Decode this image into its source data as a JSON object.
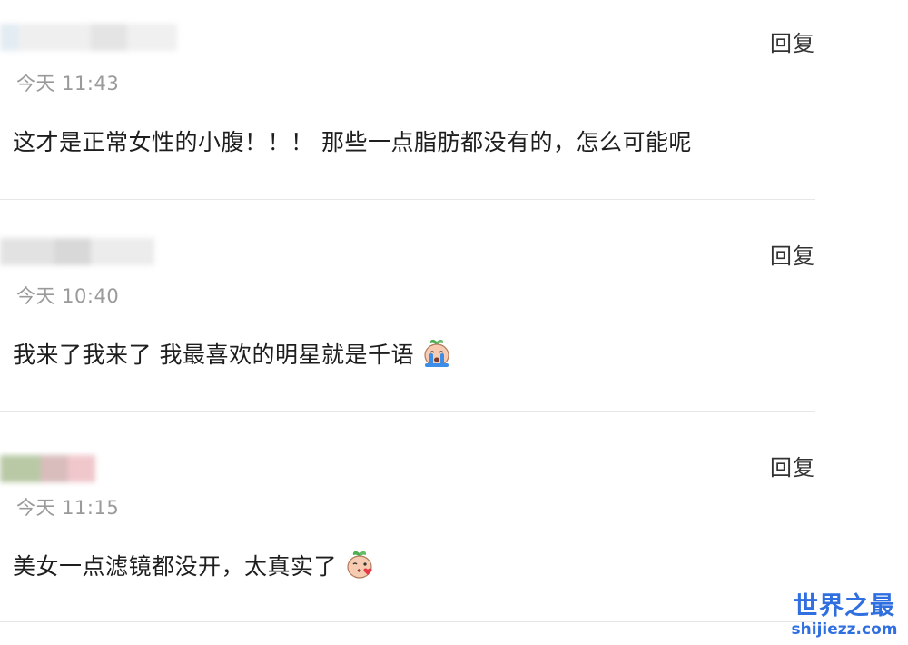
{
  "reply_label": "回复",
  "comments": [
    {
      "time": "今天 11:43",
      "text": "这才是正常女性的小腹！！！ 那些一点脂肪都没有的，怎么可能呢",
      "emoji": ""
    },
    {
      "time": "今天 10:40",
      "text": "我来了我来了 我最喜欢的明星就是千语",
      "emoji": "crying-turnip-icon"
    },
    {
      "time": "今天 11:15",
      "text": "美女一点滤镜都没开，太真实了",
      "emoji": "kissing-turnip-icon"
    }
  ],
  "watermark": {
    "title": "世界之最",
    "url": "shijiezz.com"
  },
  "colors": {
    "time_gray": "#9a9a9a",
    "divider": "#e6e6e6",
    "watermark_blue": "#2f6fe0"
  }
}
